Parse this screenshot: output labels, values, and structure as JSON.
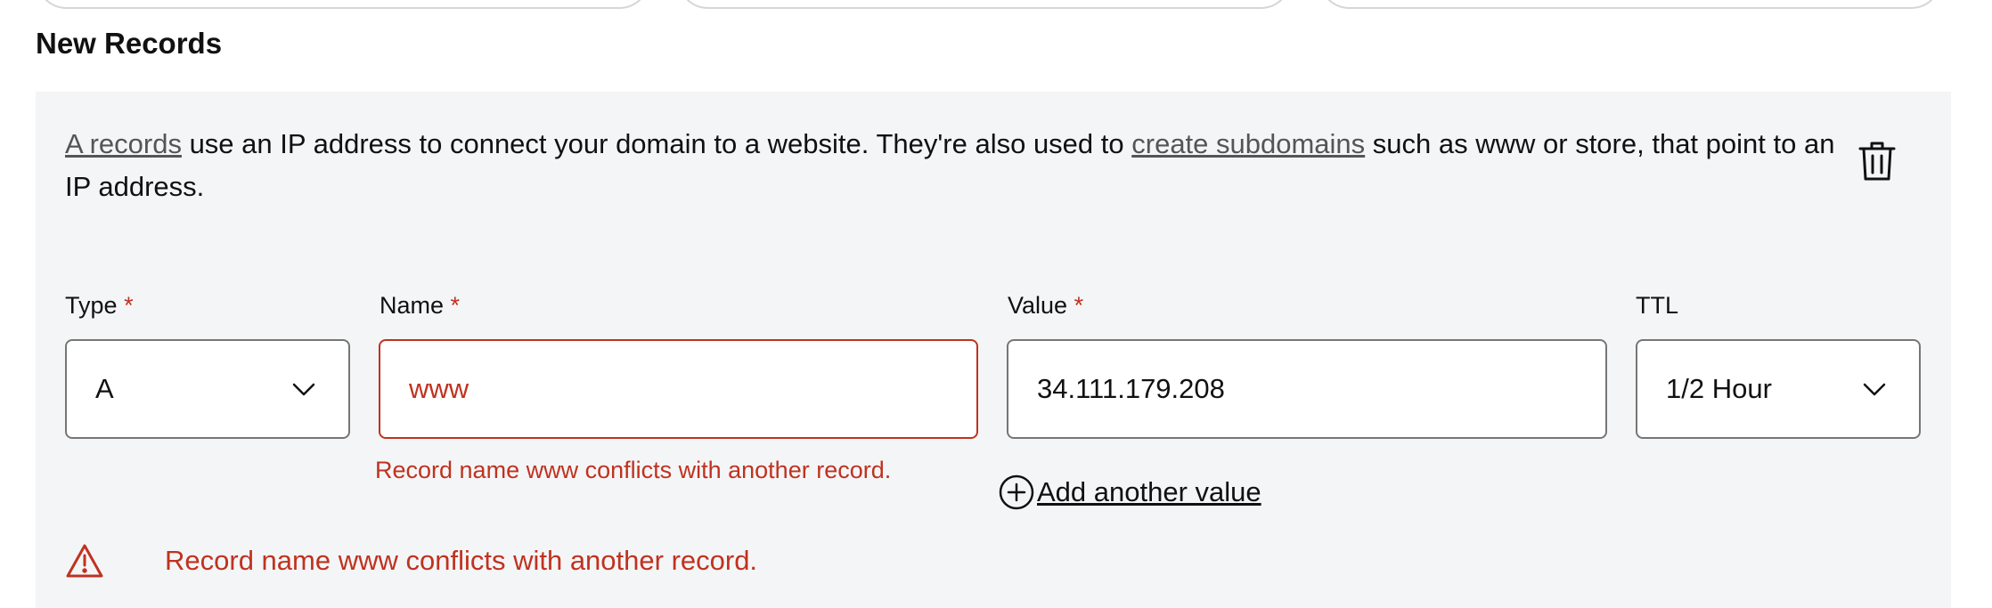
{
  "section": {
    "title": "New Records"
  },
  "description": {
    "link_a_records": "A records",
    "text_1": " use an IP address to connect your domain to a website. They're also used to ",
    "link_subdomains": "create subdomains",
    "text_2": " such as www or store, that point to an IP address."
  },
  "fields": {
    "type": {
      "label": "Type",
      "required_mark": "*",
      "value": "A"
    },
    "name": {
      "label": "Name",
      "required_mark": "*",
      "value": "www",
      "error": "Record name www conflicts with another record."
    },
    "value": {
      "label": "Value",
      "required_mark": "*",
      "value": "34.111.179.208"
    },
    "ttl": {
      "label": "TTL",
      "value": "1/2 Hour"
    }
  },
  "actions": {
    "add_another_value": "Add another value"
  },
  "banner": {
    "message": "Record name www conflicts with another record."
  },
  "colors": {
    "error": "#c0321f",
    "panel_bg": "#f4f5f7",
    "border": "#767676"
  },
  "icons": {
    "delete": "trash-icon",
    "add": "plus-circle-icon",
    "warning": "warning-triangle-icon",
    "dropdown": "chevron-down-icon"
  }
}
